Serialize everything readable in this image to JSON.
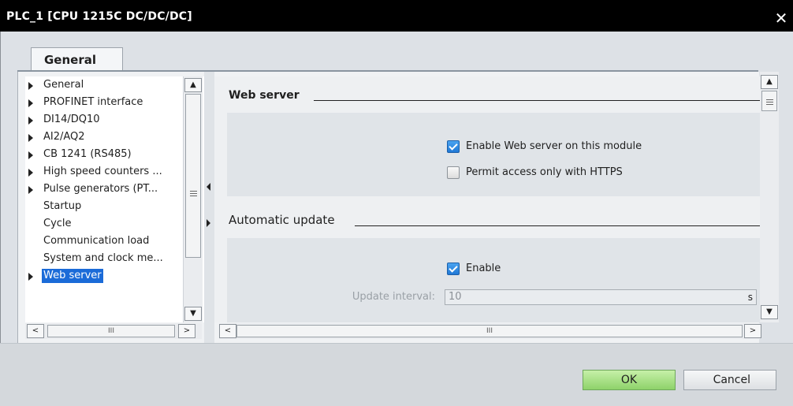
{
  "window": {
    "title": "PLC_1 [CPU 1215C DC/DC/DC]",
    "close_glyph": "✕"
  },
  "tab": {
    "label": "General"
  },
  "tree": {
    "items": [
      {
        "label": "General",
        "has_arrow": true
      },
      {
        "label": "PROFINET interface",
        "has_arrow": true
      },
      {
        "label": "DI14/DQ10",
        "has_arrow": true
      },
      {
        "label": "AI2/AQ2",
        "has_arrow": true
      },
      {
        "label": "CB 1241 (RS485)",
        "has_arrow": true
      },
      {
        "label": "High speed counters ...",
        "has_arrow": true
      },
      {
        "label": "Pulse generators (PT...",
        "has_arrow": true
      },
      {
        "label": "Startup",
        "has_arrow": false
      },
      {
        "label": "Cycle",
        "has_arrow": false
      },
      {
        "label": "Communication load",
        "has_arrow": false
      },
      {
        "label": "System and clock me...",
        "has_arrow": false
      },
      {
        "label": "Web server",
        "has_arrow": true,
        "selected": true
      }
    ]
  },
  "content": {
    "web_server": {
      "title": "Web server",
      "enable_label": "Enable Web server on this module",
      "enable_checked": true,
      "https_label": "Permit access only with HTTPS",
      "https_checked": false
    },
    "auto_update": {
      "title": "Automatic update",
      "enable_label": "Enable",
      "enable_checked": true,
      "interval_label": "Update interval:",
      "interval_value": "10",
      "interval_unit": "s"
    }
  },
  "scroll": {
    "up": "▲",
    "down": "▼",
    "left": "<",
    "right": ">",
    "grip": "III",
    "grip_v": "≡"
  },
  "buttons": {
    "ok": "OK",
    "cancel": "Cancel"
  },
  "colors": {
    "selection": "#1b6bd8",
    "ok_button": "#9ad878",
    "titlebar": "#000000"
  }
}
